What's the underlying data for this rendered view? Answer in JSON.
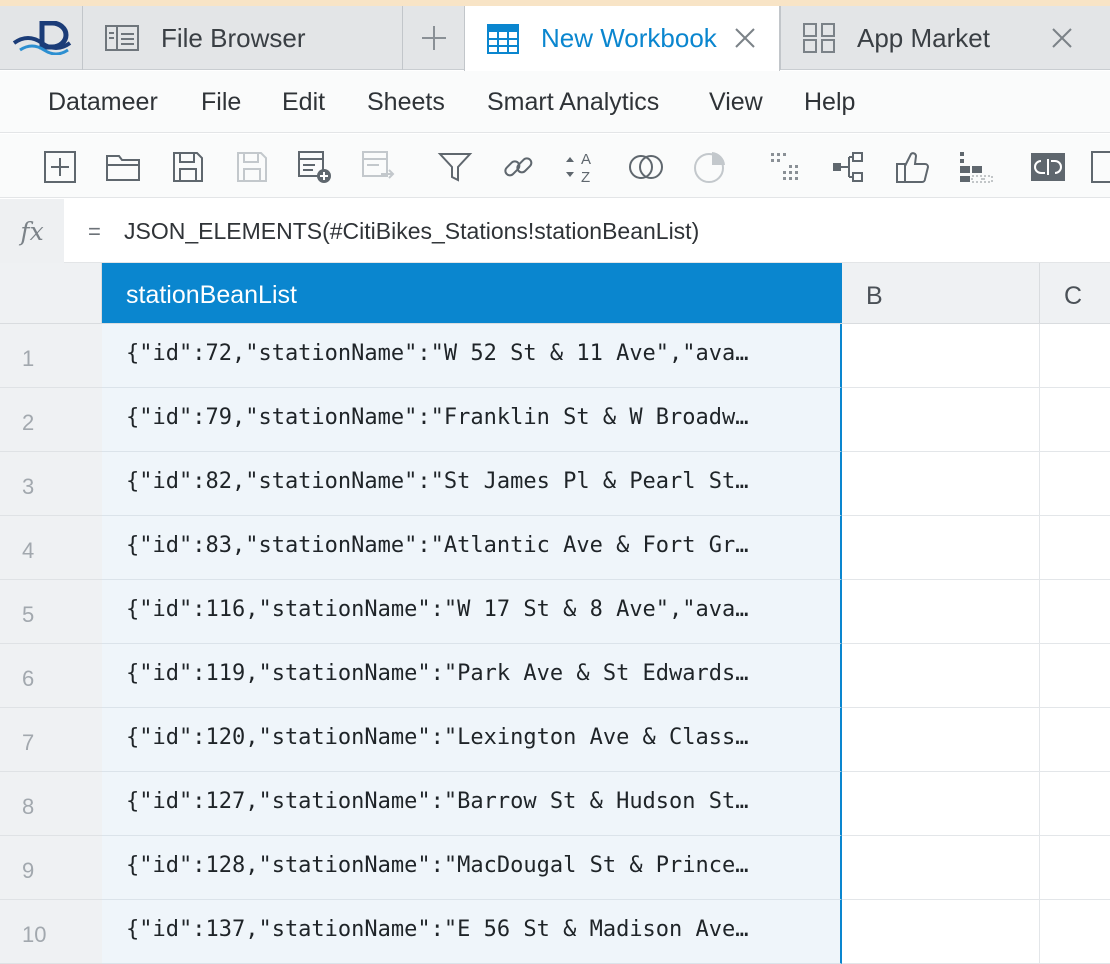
{
  "tabs": {
    "file_browser": {
      "label": "File Browser",
      "icon": "file-browser-icon"
    },
    "add_tab": {
      "icon": "plus-icon"
    },
    "workbook": {
      "label": "New Workbook",
      "icon": "table-icon",
      "active": true
    },
    "app_market": {
      "label": "App Market",
      "icon": "grid-icon"
    }
  },
  "menu": {
    "items": [
      "Datameer",
      "File",
      "Edit",
      "Sheets",
      "Smart Analytics",
      "View",
      "Help"
    ]
  },
  "toolbar": {
    "buttons": [
      "add-sheet-icon",
      "open-folder-icon",
      "save-icon",
      "save-as-icon",
      "add-data-icon",
      "join-data-icon",
      "filter-icon",
      "link-icon",
      "sort-az-icon",
      "union-icon",
      "pie-chart-icon",
      "clustering-icon",
      "decision-tree-icon",
      "recommendation-icon",
      "column-dependencies-icon",
      "unlink-icon",
      "sidebar-icon"
    ]
  },
  "formula": {
    "fx_label": "fx",
    "equals": "=",
    "expression": "JSON_ELEMENTS(#CitiBikes_Stations!stationBeanList)"
  },
  "grid": {
    "columns": {
      "a": "stationBeanList",
      "b": "B",
      "c": "C"
    },
    "rows": [
      {
        "num": "1",
        "value": "{\"id\":72,\"stationName\":\"W 52 St & 11 Ave\",\"ava…"
      },
      {
        "num": "2",
        "value": "{\"id\":79,\"stationName\":\"Franklin St & W Broadw…"
      },
      {
        "num": "3",
        "value": "{\"id\":82,\"stationName\":\"St James Pl & Pearl St…"
      },
      {
        "num": "4",
        "value": "{\"id\":83,\"stationName\":\"Atlantic Ave & Fort Gr…"
      },
      {
        "num": "5",
        "value": "{\"id\":116,\"stationName\":\"W 17 St & 8 Ave\",\"ava…"
      },
      {
        "num": "6",
        "value": "{\"id\":119,\"stationName\":\"Park Ave & St Edwards…"
      },
      {
        "num": "7",
        "value": "{\"id\":120,\"stationName\":\"Lexington Ave & Class…"
      },
      {
        "num": "8",
        "value": "{\"id\":127,\"stationName\":\"Barrow St & Hudson St…"
      },
      {
        "num": "9",
        "value": "{\"id\":128,\"stationName\":\"MacDougal St & Prince…"
      },
      {
        "num": "10",
        "value": "{\"id\":137,\"stationName\":\"E 56 St & Madison Ave…"
      }
    ]
  },
  "colors": {
    "accent": "#0a86cf",
    "top_line": "#f8e4c6"
  }
}
